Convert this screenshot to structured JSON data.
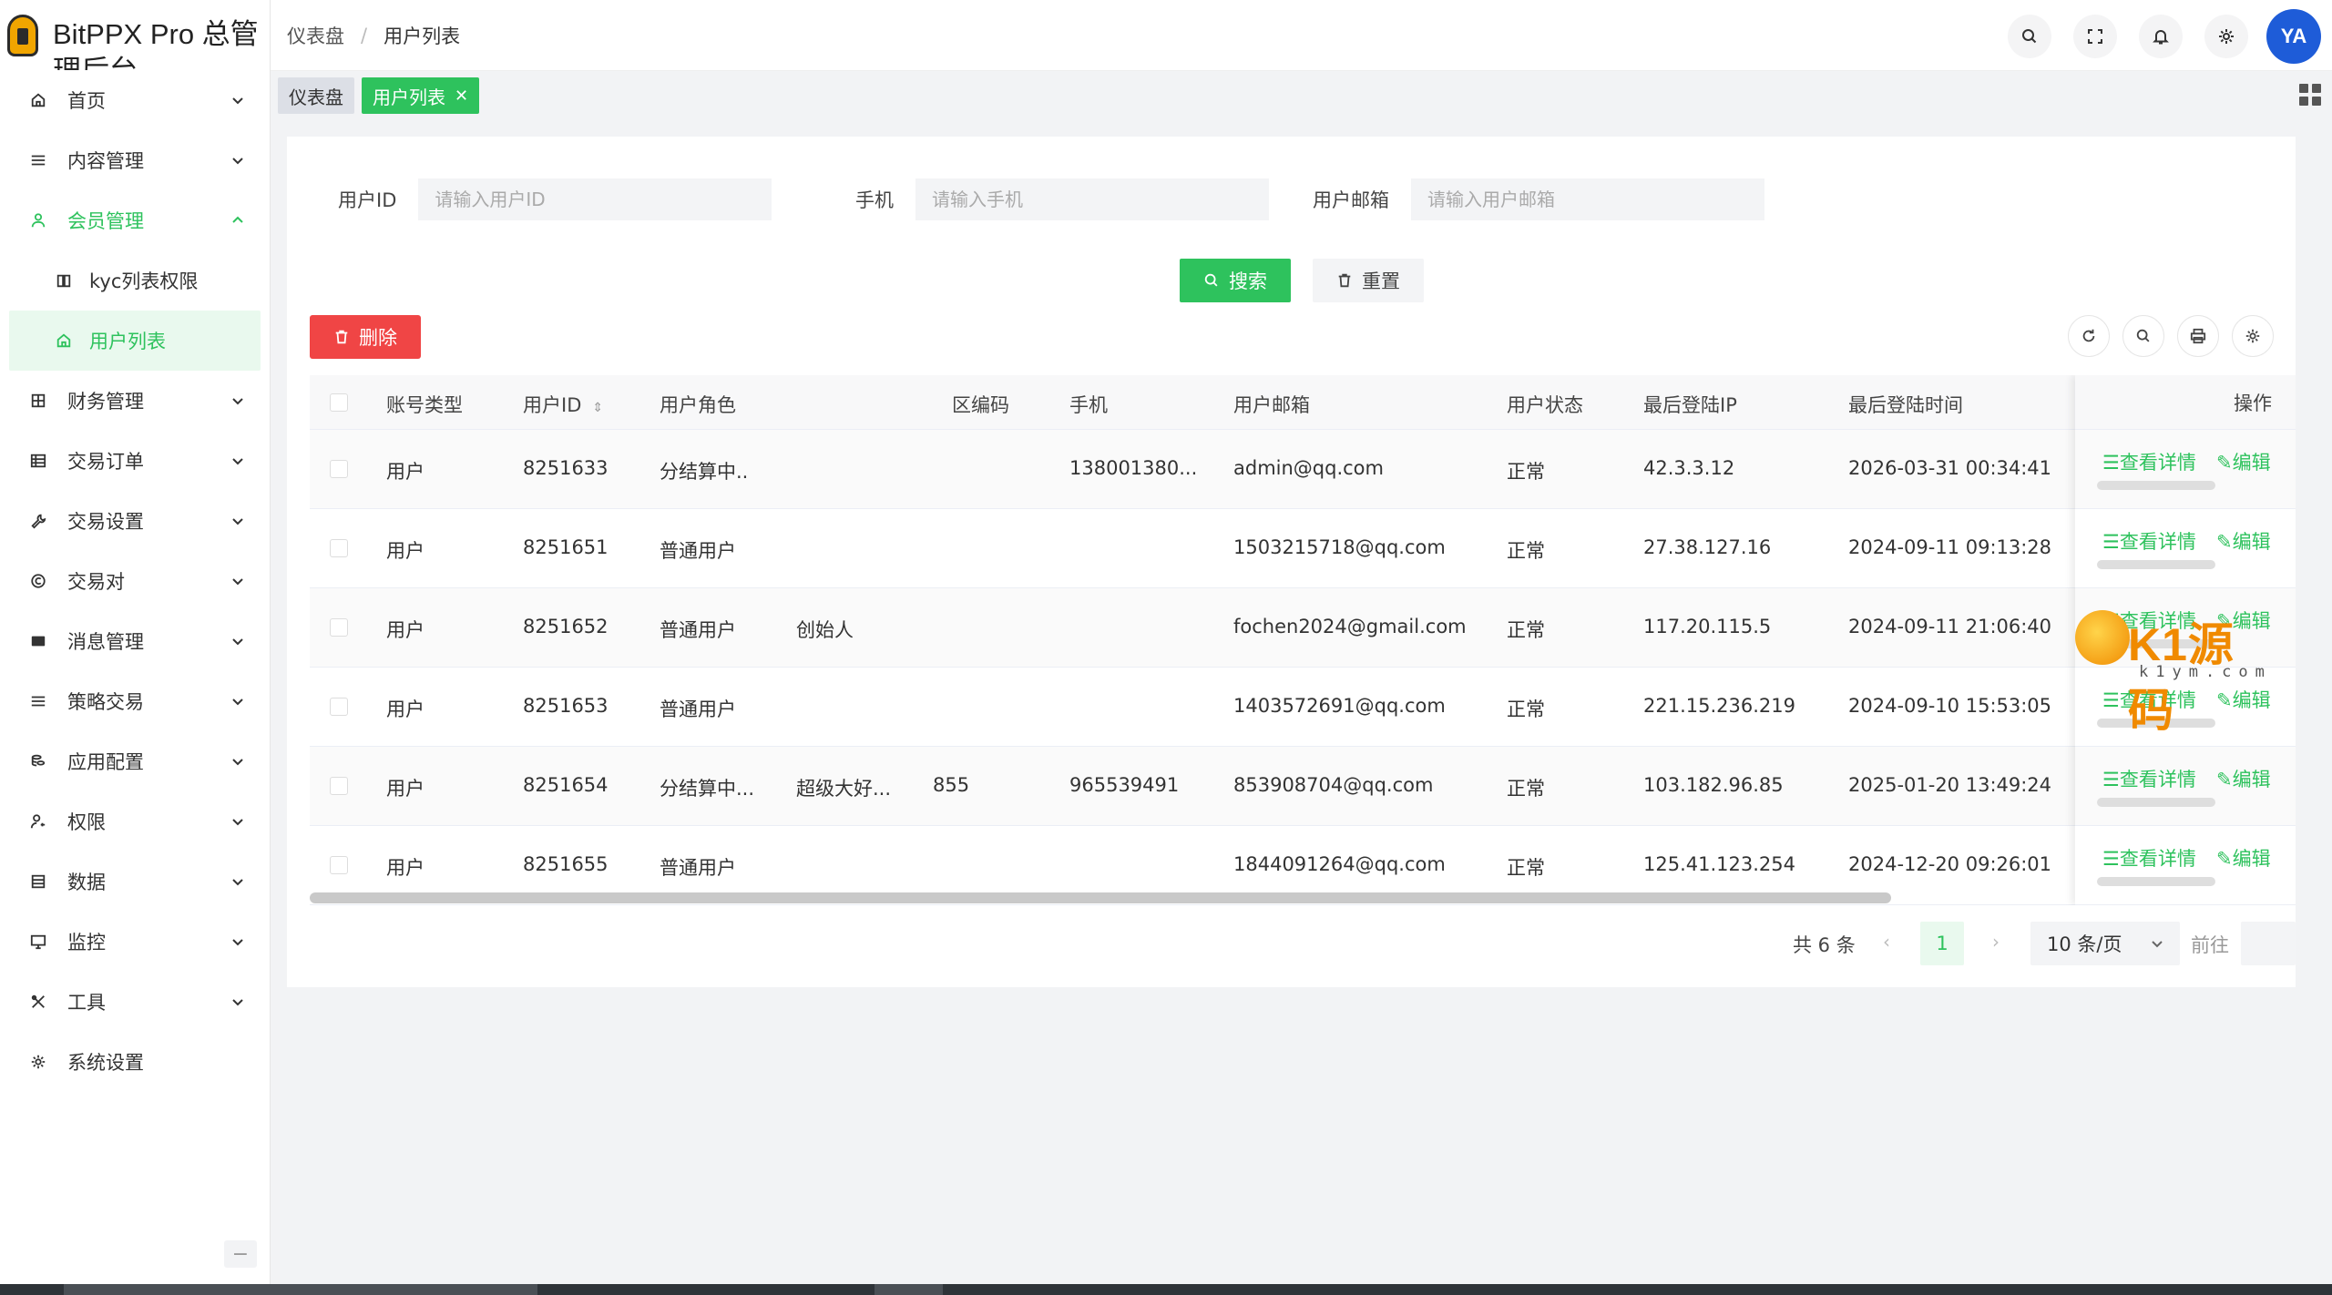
{
  "app": {
    "title": "BitPPX Pro 总管理后台"
  },
  "breadcrumb": {
    "home": "仪表盘",
    "separator": "/",
    "current": "用户列表"
  },
  "tags": {
    "dashboard": "仪表盘",
    "current": "用户列表",
    "close": "✕"
  },
  "sidebar": {
    "items": [
      {
        "label": "首页",
        "icon": "home-icon"
      },
      {
        "label": "内容管理",
        "icon": "list-icon"
      },
      {
        "label": "会员管理",
        "icon": "user-icon"
      },
      {
        "label": "kyc列表权限",
        "icon": "book-icon"
      },
      {
        "label": "用户列表",
        "icon": "home-icon"
      },
      {
        "label": "财务管理",
        "icon": "grid-icon"
      },
      {
        "label": "交易订单",
        "icon": "table-icon"
      },
      {
        "label": "交易设置",
        "icon": "wrench-icon"
      },
      {
        "label": "交易对",
        "icon": "copyright-icon"
      },
      {
        "label": "消息管理",
        "icon": "message-icon"
      },
      {
        "label": "策略交易",
        "icon": "menu-icon"
      },
      {
        "label": "应用配置",
        "icon": "coins-icon"
      },
      {
        "label": "权限",
        "icon": "user-key-icon"
      },
      {
        "label": "数据",
        "icon": "database-icon"
      },
      {
        "label": "监控",
        "icon": "monitor-icon"
      },
      {
        "label": "工具",
        "icon": "tools-icon"
      },
      {
        "label": "系统设置",
        "icon": "gear-icon"
      }
    ],
    "collapse": "−"
  },
  "header": {
    "avatar_text": "YA"
  },
  "search_form": {
    "userid_label": "用户ID",
    "userid_placeholder": "请输入用户ID",
    "phone_label": "手机",
    "phone_placeholder": "请输入手机",
    "email_label": "用户邮箱",
    "email_placeholder": "请输入用户邮箱",
    "search_button": "搜索",
    "reset_button": "重置"
  },
  "toolbar": {
    "delete_button": "删除"
  },
  "table": {
    "columns": [
      "账号类型",
      "用户ID",
      "用户角色",
      "区编码",
      "手机",
      "用户邮箱",
      "用户状态",
      "最后登陆IP",
      "最后登陆时间",
      "操作"
    ],
    "role_header_visible": "用户角色",
    "rows": [
      {
        "type": "用户",
        "id": "8251633",
        "role": "分结算中..",
        "tag": "",
        "area": "",
        "phone": "138001380...",
        "email": "admin@qq.com",
        "status": "正常",
        "ip": "42.3.3.12",
        "time": "2026-03-31 00:34:41"
      },
      {
        "type": "用户",
        "id": "8251651",
        "role": "普通用户",
        "tag": "",
        "area": "",
        "phone": "",
        "email": "1503215718@qq.com",
        "status": "正常",
        "ip": "27.38.127.16",
        "time": "2024-09-11 09:13:28"
      },
      {
        "type": "用户",
        "id": "8251652",
        "role": "普通用户",
        "tag": "创始人",
        "area": "",
        "phone": "",
        "email": "fochen2024@gmail.com",
        "status": "正常",
        "ip": "117.20.115.5",
        "time": "2024-09-11 21:06:40"
      },
      {
        "type": "用户",
        "id": "8251653",
        "role": "普通用户",
        "tag": "",
        "area": "",
        "phone": "",
        "email": "1403572691@qq.com",
        "status": "正常",
        "ip": "221.15.236.219",
        "time": "2024-09-10 15:53:05"
      },
      {
        "type": "用户",
        "id": "8251654",
        "role": "分结算中...",
        "tag": "超级大好...",
        "area": "855",
        "phone": "965539491",
        "email": "853908704@qq.com",
        "status": "正常",
        "ip": "103.182.96.85",
        "time": "2025-01-20 13:49:24"
      },
      {
        "type": "用户",
        "id": "8251655",
        "role": "普通用户",
        "tag": "",
        "area": "",
        "phone": "",
        "email": "1844091264@qq.com",
        "status": "正常",
        "ip": "125.41.123.254",
        "time": "2024-12-20 09:26:01"
      }
    ],
    "action_view": "☰查看详情",
    "action_edit": "✎编辑"
  },
  "pagination": {
    "total": "共 6 条",
    "prev": "‹",
    "page": "1",
    "next": "›",
    "size": "10 条/页",
    "goto": "前往"
  },
  "watermark": {
    "text": "K1源码",
    "sub": "k1ym.com"
  },
  "colors": {
    "accent": "#2ec25d",
    "danger": "#f04545",
    "avatar": "#1e5cd8"
  }
}
